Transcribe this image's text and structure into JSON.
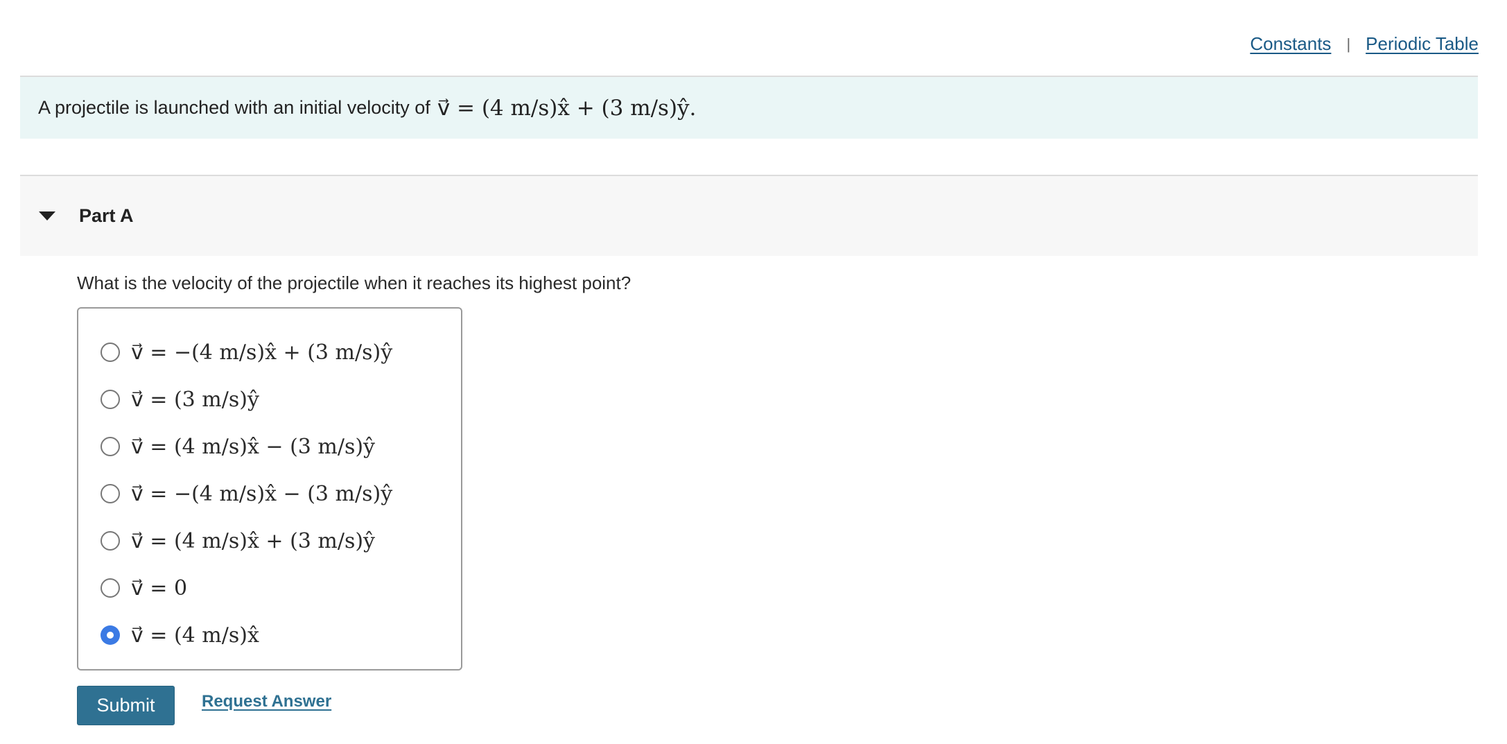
{
  "header": {
    "links": [
      "Constants",
      "Periodic Table"
    ],
    "separator": "|"
  },
  "intro": {
    "text": "A projectile is launched with an initial velocity of",
    "formula": "v⃗ = (4 m/s)x̂ + (3 m/s)ŷ."
  },
  "part": {
    "title": "Part A",
    "expanded": true
  },
  "question": {
    "text": "What is the velocity of the projectile when it reaches its highest point?",
    "options": [
      "v⃗ = −(4 m/s)x̂ + (3 m/s)ŷ",
      "v⃗ = (3 m/s)ŷ",
      "v⃗ = (4 m/s)x̂ − (3 m/s)ŷ",
      "v⃗ = −(4 m/s)x̂ − (3 m/s)ŷ",
      "v⃗ = (4 m/s)x̂ + (3 m/s)ŷ",
      "v⃗ = 0",
      "v⃗ = (4 m/s)x̂"
    ],
    "selected_index": 6
  },
  "actions": {
    "submit_label": "Submit",
    "request_label": "Request Answer"
  },
  "colors": {
    "accent": "#2f7192",
    "radio_selected": "#3b7ae4",
    "intro_bg": "#eaf6f6",
    "link": "#1a5a86"
  }
}
